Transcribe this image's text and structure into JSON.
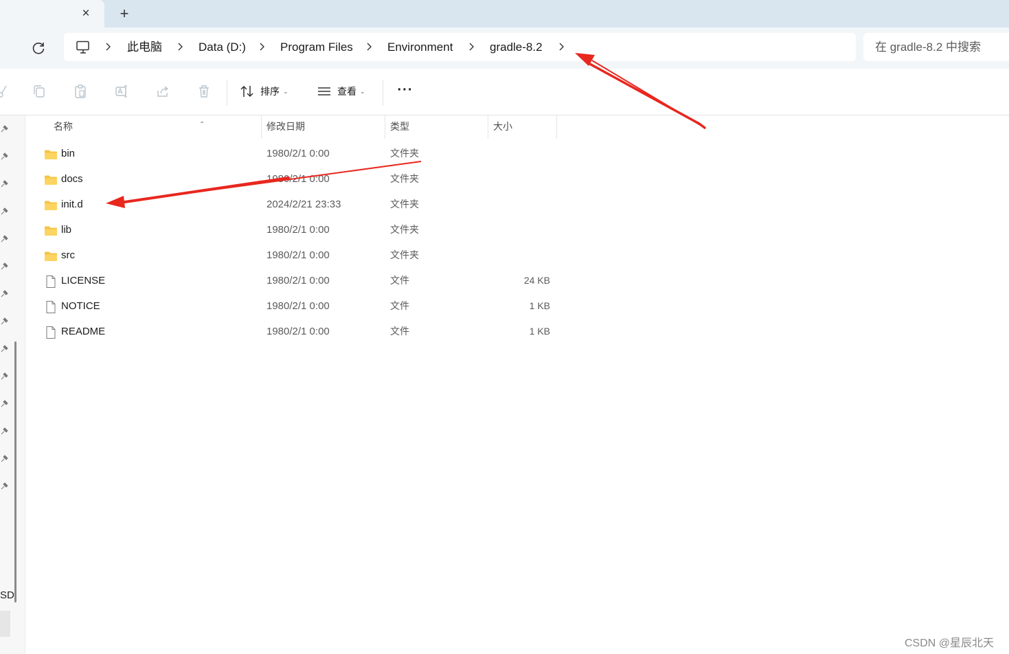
{
  "tabs": {
    "close_symbol": "×",
    "new_tab_symbol": "+"
  },
  "breadcrumb": {
    "items": [
      "此电脑",
      "Data (D:)",
      "Program Files",
      "Environment",
      "gradle-8.2"
    ]
  },
  "search": {
    "placeholder": "在 gradle-8.2 中搜索"
  },
  "toolbar": {
    "sort_label": "排序",
    "view_label": "查看",
    "more_label": "···"
  },
  "nav": {
    "truncated_label": "SD"
  },
  "columns": {
    "name": "名称",
    "modified": "修改日期",
    "type": "类型",
    "size": "大小"
  },
  "files": [
    {
      "name": "bin",
      "modified": "1980/2/1 0:00",
      "type": "文件夹",
      "size": "",
      "icon": "folder-icon"
    },
    {
      "name": "docs",
      "modified": "1980/2/1 0:00",
      "type": "文件夹",
      "size": "",
      "icon": "folder-icon"
    },
    {
      "name": "init.d",
      "modified": "2024/2/21 23:33",
      "type": "文件夹",
      "size": "",
      "icon": "folder-icon"
    },
    {
      "name": "lib",
      "modified": "1980/2/1 0:00",
      "type": "文件夹",
      "size": "",
      "icon": "folder-icon"
    },
    {
      "name": "src",
      "modified": "1980/2/1 0:00",
      "type": "文件夹",
      "size": "",
      "icon": "folder-icon"
    },
    {
      "name": "LICENSE",
      "modified": "1980/2/1 0:00",
      "type": "文件",
      "size": "24 KB",
      "icon": "file-icon"
    },
    {
      "name": "NOTICE",
      "modified": "1980/2/1 0:00",
      "type": "文件",
      "size": "1 KB",
      "icon": "file-icon"
    },
    {
      "name": "README",
      "modified": "1980/2/1 0:00",
      "type": "文件",
      "size": "1 KB",
      "icon": "file-icon"
    }
  ],
  "watermark": "CSDN @星辰北天",
  "colors": {
    "arrow": "#e8271f",
    "folder": "#f6c445",
    "chrome_bg": "#f2f6f9",
    "tabstrip_bg": "#d9e5ef"
  }
}
